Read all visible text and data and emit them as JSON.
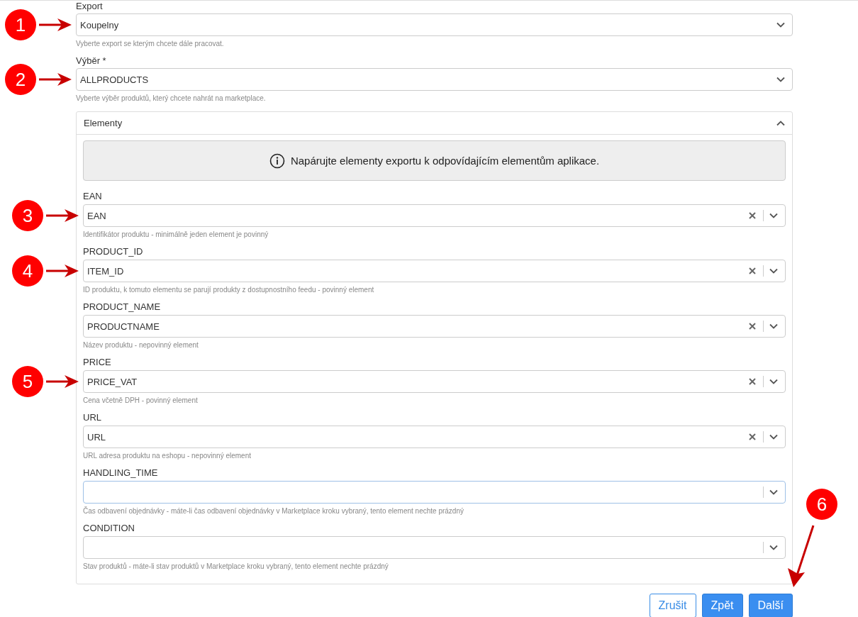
{
  "export": {
    "label": "Export",
    "value": "Koupelny",
    "hint": "Vyberte export se kterým chcete dále pracovat.",
    "marker": "1"
  },
  "selection": {
    "label": "Výběr *",
    "value": "ALLPRODUCTS",
    "hint": "Vyberte výběr produktů, který chcete nahrát na marketplace.",
    "marker": "2"
  },
  "elements_panel": {
    "title": "Elementy",
    "expanded": true,
    "info": "Napárujte elementy exportu k odpovídajícím elementům aplikace.",
    "fields": [
      {
        "label": "EAN",
        "value": "EAN",
        "clearable": true,
        "focused": false,
        "hint": "Identifikátor produktu - minimálně jeden element je povinný",
        "marker": "3"
      },
      {
        "label": "PRODUCT_ID",
        "value": "ITEM_ID",
        "clearable": true,
        "focused": false,
        "hint": "ID produktu, k tomuto elementu se parují produkty z dostupnostního feedu - povinný element",
        "marker": "4"
      },
      {
        "label": "PRODUCT_NAME",
        "value": "PRODUCTNAME",
        "clearable": true,
        "focused": false,
        "hint": "Název produktu - nepovinný element"
      },
      {
        "label": "PRICE",
        "value": "PRICE_VAT",
        "clearable": true,
        "focused": false,
        "hint": "Cena včetně DPH - povinný element",
        "marker": "5"
      },
      {
        "label": "URL",
        "value": "URL",
        "clearable": true,
        "focused": false,
        "hint": "URL adresa produktu na eshopu - nepovinný element"
      },
      {
        "label": "HANDLING_TIME",
        "clearable": false,
        "focused": true,
        "hint": "Čas odbavení objednávky - máte-li čas odbavení objednávky v Marketplace kroku vybraný, tento element nechte prázdný"
      },
      {
        "label": "CONDITION",
        "clearable": false,
        "focused": false,
        "hint": "Stav produktů - máte-li stav produktů v Marketplace kroku vybraný, tento element nechte prázdný"
      }
    ]
  },
  "buttons": [
    {
      "label": "Zrušit",
      "kind": "outline"
    },
    {
      "label": "Zpět",
      "kind": "primary"
    },
    {
      "label": "Další",
      "kind": "primary",
      "marker": "6"
    }
  ]
}
